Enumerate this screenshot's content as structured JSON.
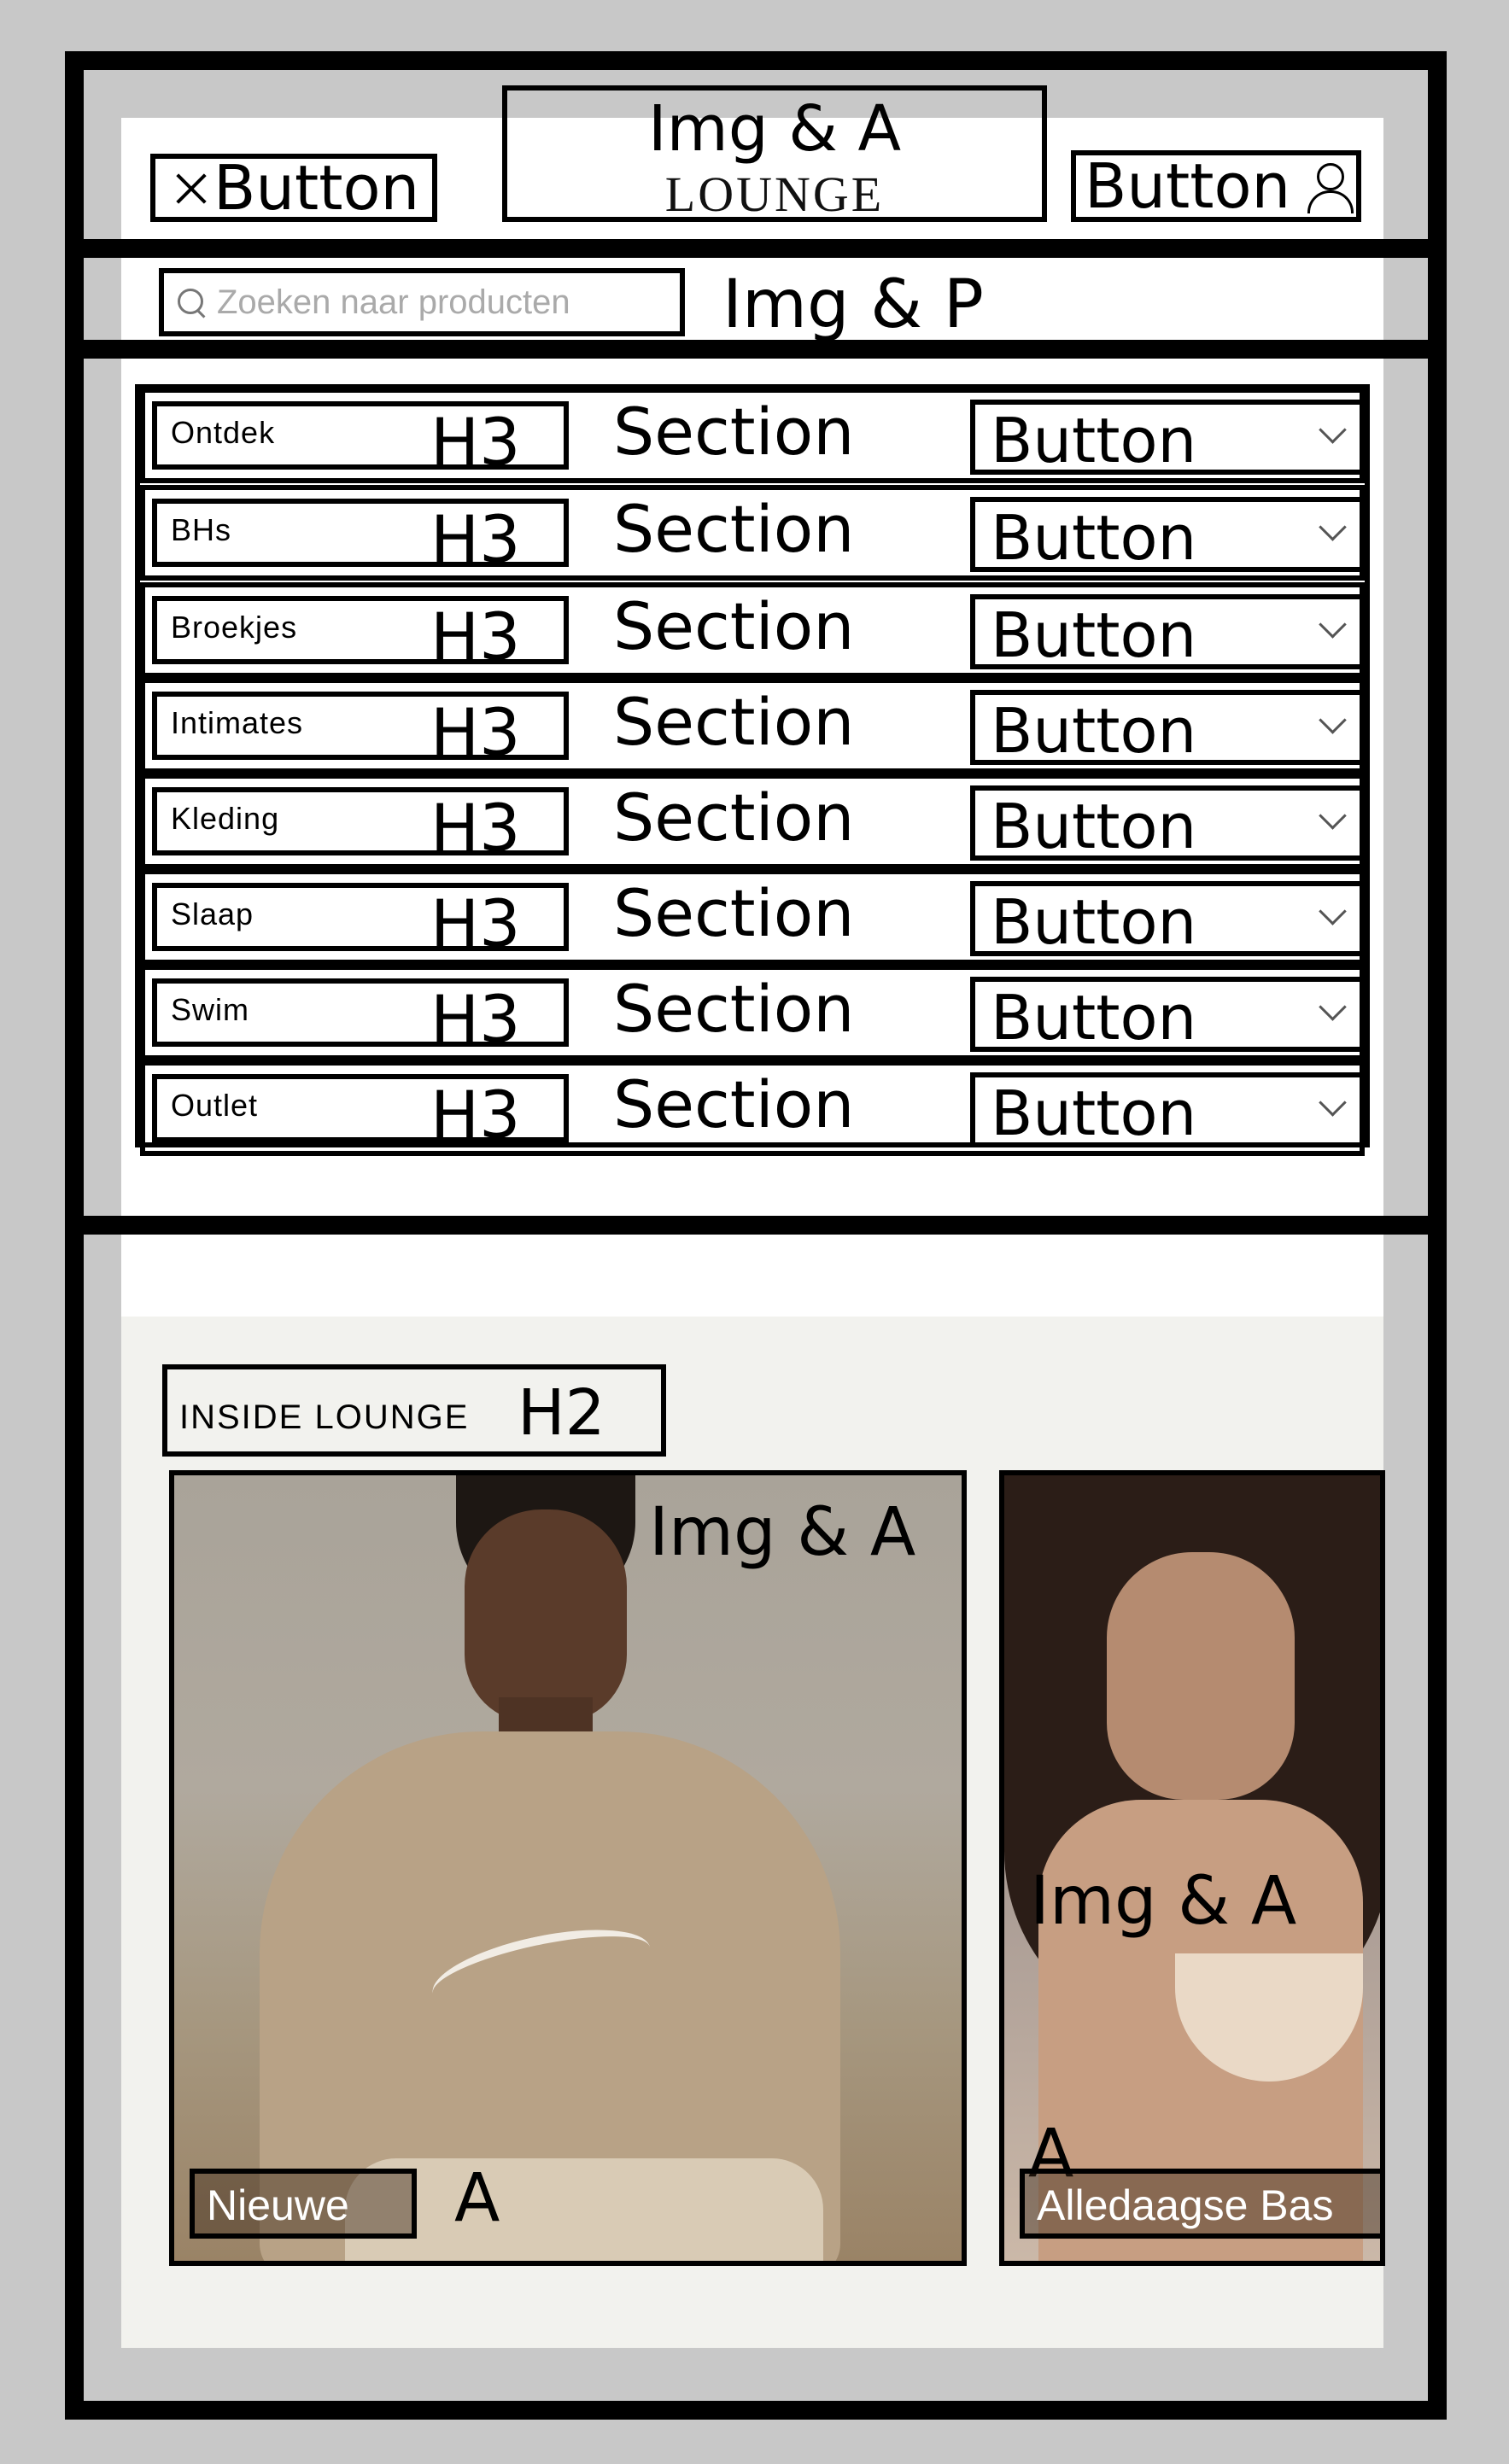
{
  "annotations": {
    "button": "Button",
    "img_and_a": "Img & A",
    "img_and_p": "Img & P",
    "h3": "H3",
    "h2": "H2",
    "section": "Section",
    "a": "A"
  },
  "header": {
    "logo_text": "LOUNGE",
    "close_icon": "close-icon",
    "account_icon": "user-icon"
  },
  "search": {
    "placeholder": "Zoeken naar producten",
    "icon": "search-icon"
  },
  "nav": {
    "items": [
      {
        "label": "Ontdek"
      },
      {
        "label": "BHs"
      },
      {
        "label": "Broekjes"
      },
      {
        "label": "Intimates"
      },
      {
        "label": "Kleding"
      },
      {
        "label": "Slaap"
      },
      {
        "label": "Swim"
      },
      {
        "label": "Outlet"
      }
    ],
    "chevron_icon": "chevron-down-icon"
  },
  "promo": {
    "title": "INSIDE LOUNGE",
    "cards": [
      {
        "label": "Nieuwe"
      },
      {
        "label": "Alledaagse Bas"
      }
    ]
  },
  "colors": {
    "frame": "#000000",
    "background": "#c8c8c8",
    "promo_background": "#f2f2ee"
  }
}
